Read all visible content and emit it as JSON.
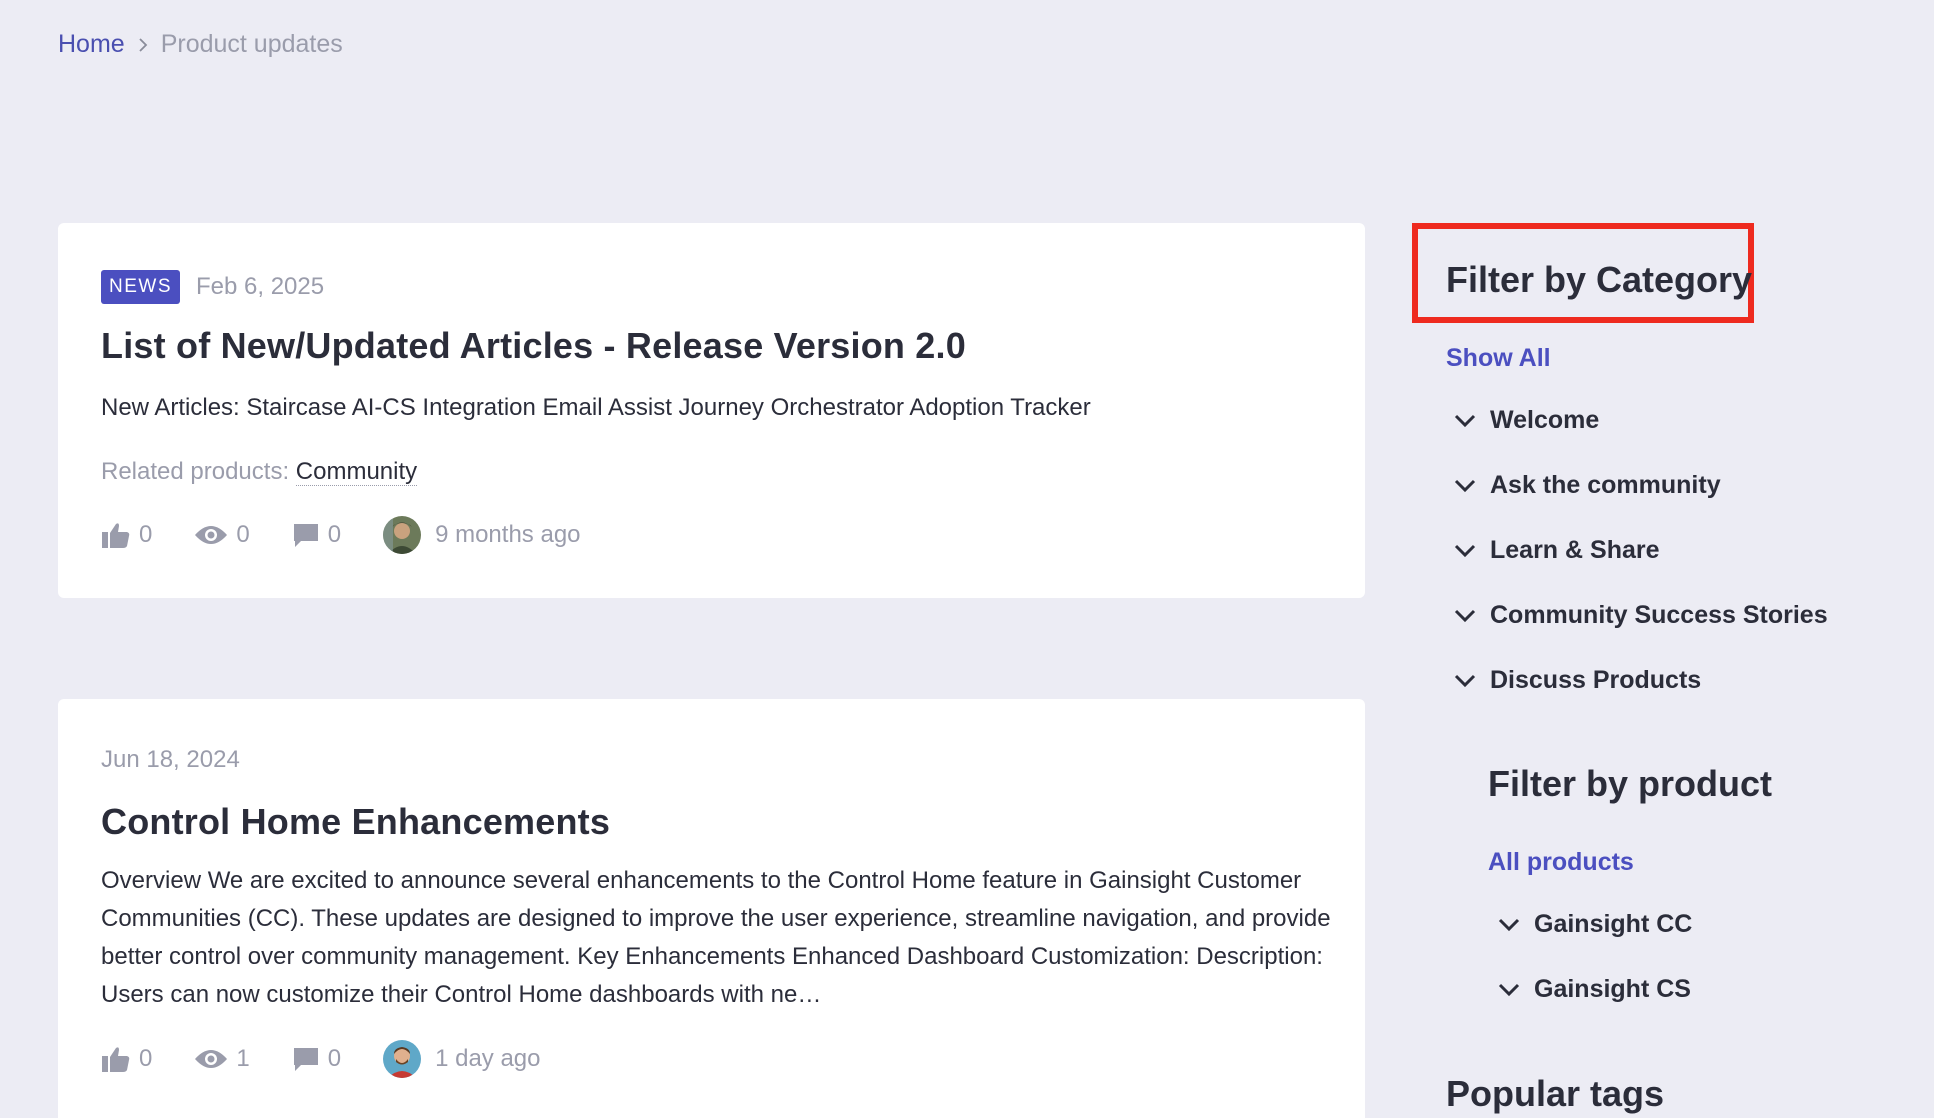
{
  "breadcrumb": {
    "home": "Home",
    "current": "Product updates"
  },
  "posts": [
    {
      "badge": "NEWS",
      "date": "Feb 6, 2025",
      "title": "List of New/Updated Articles - Release Version 2.0",
      "excerpt": "New Articles: Staircase AI-CS Integration Email Assist Journey Orchestrator  Adoption Tracker",
      "related_label": "Related products:",
      "related_value": "Community",
      "likes": "0",
      "views": "0",
      "comments": "0",
      "time": "9 months ago"
    },
    {
      "date": "Jun 18, 2024",
      "title": "Control Home Enhancements",
      "excerpt": "Overview We are excited to announce several enhancements to the Control Home feature in Gainsight Customer Communities (CC). These updates are designed to improve the user experience, streamline navigation, and provide better control over community management. Key Enhancements Enhanced Dashboard Customization: Description: Users can now customize their Control Home dashboards with ne…",
      "likes": "0",
      "views": "1",
      "comments": "0",
      "time": "1 day ago"
    }
  ],
  "sidebar": {
    "category_title": "Filter by Category",
    "show_all": "Show All",
    "categories": [
      "Welcome",
      "Ask the community",
      "Learn & Share",
      "Community Success Stories",
      "Discuss Products"
    ],
    "product_title": "Filter by product",
    "all_products": "All products",
    "products": [
      "Gainsight CC",
      "Gainsight CS"
    ],
    "tags_title": "Popular tags"
  },
  "colors": {
    "accent": "#4b4fc0",
    "highlight_box": "#ee2a1f",
    "background": "#ececf4"
  }
}
